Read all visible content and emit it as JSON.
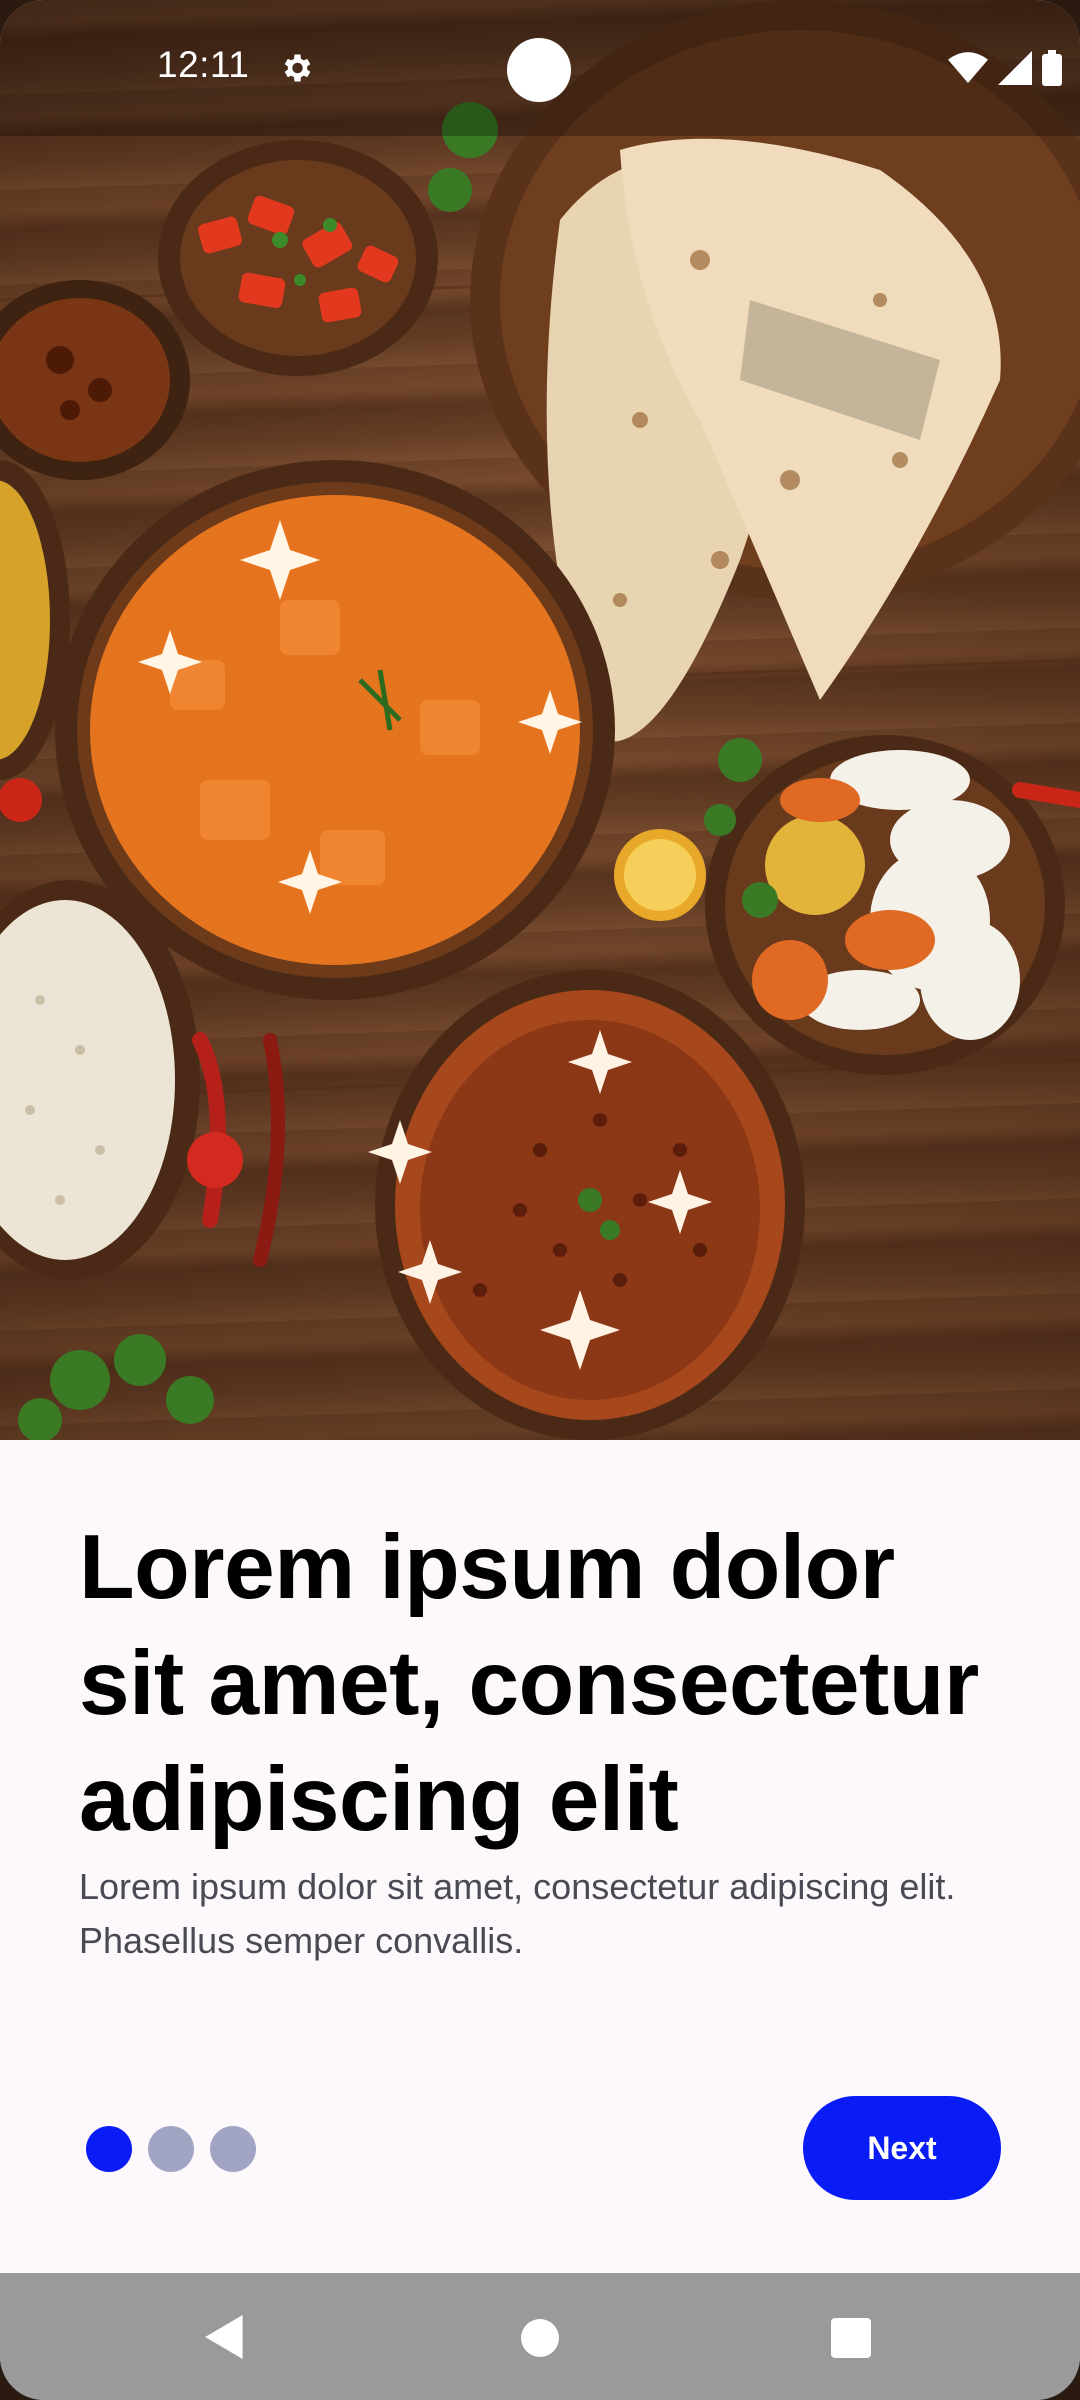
{
  "status_bar": {
    "time": "12:11",
    "settings_icon": "gear-icon",
    "wifi_icon": "wifi-icon",
    "signal_icon": "cell-signal-icon",
    "battery_icon": "battery-icon"
  },
  "hero": {
    "image": "indian-food-spread-photo"
  },
  "onboarding": {
    "headline": "Lorem ipsum dolor sit amet, consectetur adipiscing elit",
    "body": "Lorem ipsum dolor sit amet, consectetur adipiscing elit. Phasellus semper convallis.",
    "page_count": 3,
    "current_page": 1,
    "next_label": "Next"
  },
  "colors": {
    "accent": "#0a1cf5",
    "inactive_dot": "#a1a5c3",
    "background": "#fdf8fc"
  },
  "nav_bar": {
    "back_icon": "back-triangle-icon",
    "home_icon": "home-circle-icon",
    "recents_icon": "recents-square-icon"
  }
}
